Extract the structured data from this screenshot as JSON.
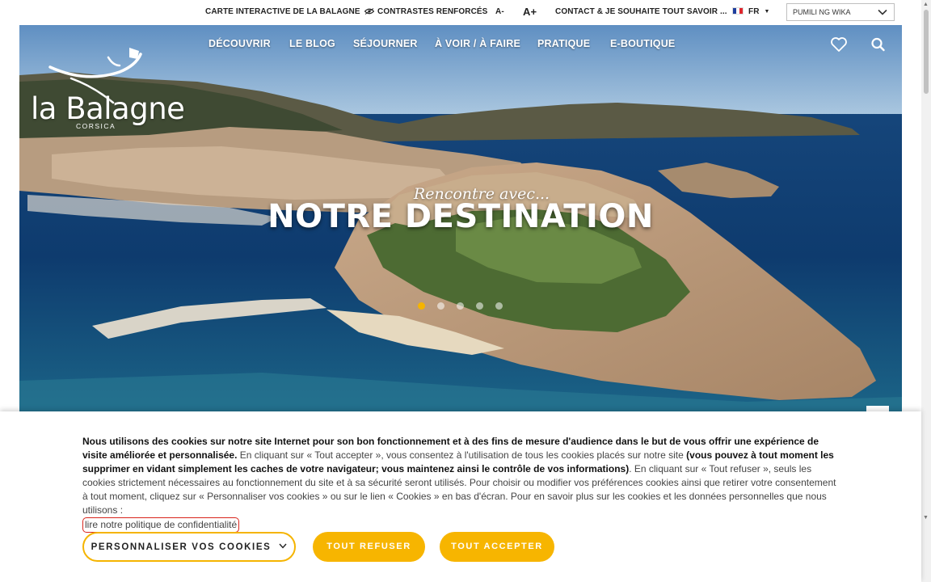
{
  "topbar": {
    "map_link": "CARTE INTERACTIVE DE LA BALAGNE",
    "contrast_link": "CONTRASTES RENFORCÉS",
    "font_smaller": "A-",
    "font_larger": "A+",
    "contact_link": "CONTACT & JE SOUHAITE TOUT SAVOIR ...",
    "language": "FR",
    "translate_select": "PUMILI NG WIKA"
  },
  "nav": {
    "items": [
      "DÉCOUVRIR",
      "LE BLOG",
      "SÉJOURNER",
      "À VOIR / À FAIRE",
      "PRATIQUE",
      "E-BOUTIQUE"
    ]
  },
  "logo": {
    "name": "la Balagne",
    "sub": "CORSICA"
  },
  "hero": {
    "tagline": "Rencontre avec...",
    "headline": "NOTRE DESTINATION",
    "slides_total": 5,
    "active_slide": 1
  },
  "cookie": {
    "p1_bold": "Nous utilisons des cookies sur notre site Internet pour son bon fonctionnement et à des fins de mesure d'audience dans le but de vous offrir une expérience de visite améliorée et personnalisée.",
    "p2": " En cliquant sur « Tout accepter », vous consentez à l'utilisation de tous les cookies placés sur notre site ",
    "p3_bold": "(vous pouvez à tout moment les supprimer en vidant simplement les caches de votre navigateur; vous maintenez ainsi le contrôle de vos informations)",
    "p4": ". En cliquant sur « Tout refuser », seuls les cookies strictement nécessaires au fonctionnement du site et à sa sécurité seront utilisés. Pour choisir ou modifier vos préférences cookies ainsi que retirer votre consentement à tout moment, cliquez sur « Personnaliser vos cookies » ou sur le lien « Cookies » en bas d'écran. Pour en savoir plus sur les cookies et les données personnelles que nous utilisons :",
    "privacy_link": "lire notre politique de confidentialité",
    "btn_customize": "PERSONNALISER VOS COOKIES",
    "btn_refuse": "TOUT REFUSER",
    "btn_accept": "TOUT ACCEPTER"
  },
  "colors": {
    "accent": "#f7b500",
    "link_highlight": "#d9241c"
  }
}
